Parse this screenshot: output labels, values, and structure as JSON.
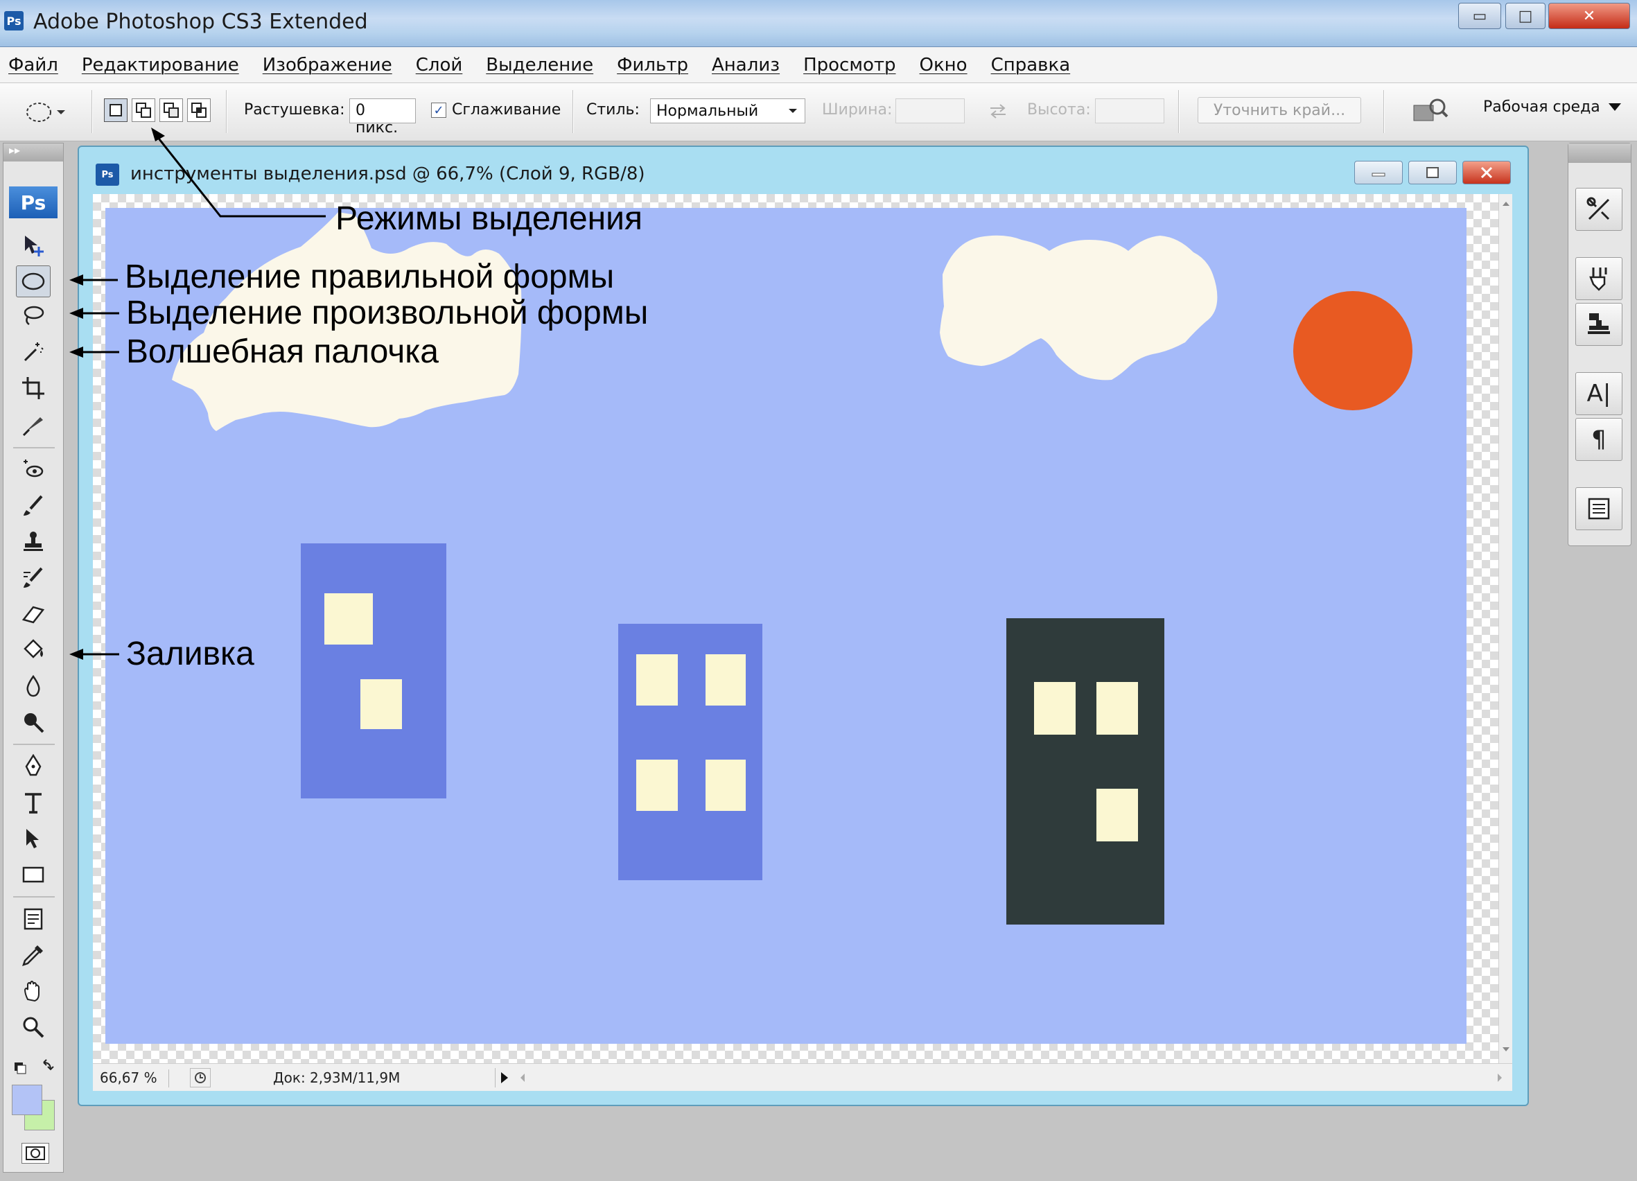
{
  "titlebar": {
    "app_badge": "Ps",
    "title": "Adobe Photoshop CS3 Extended",
    "minimize": "▭",
    "maximize": "□",
    "close": "✕"
  },
  "menu": {
    "items": [
      "Файл",
      "Редактирование",
      "Изображение",
      "Слой",
      "Выделение",
      "Фильтр",
      "Анализ",
      "Просмотр",
      "Окно",
      "Справка"
    ]
  },
  "options": {
    "feather_label": "Растушевка:",
    "feather_value": "0 пикс.",
    "antialias_label": "Сглаживание",
    "antialias_checked": "✓",
    "style_label": "Стиль:",
    "style_value": "Нормальный",
    "width_label": "Ширина:",
    "height_label": "Высота:",
    "refine_edge": "Уточнить край...",
    "workspace": "Рабочая среда"
  },
  "toolbox": {
    "header": "▸▸",
    "logo": "Ps",
    "tools": [
      "move-tool",
      "elliptical-marquee-tool",
      "lasso-tool",
      "magic-wand-tool",
      "crop-tool",
      "slice-tool",
      "spot-healing-tool",
      "brush-tool",
      "clone-stamp-tool",
      "history-brush-tool",
      "eraser-tool",
      "paint-bucket-tool",
      "blur-tool",
      "dodge-tool",
      "pen-tool",
      "type-tool",
      "path-selection-tool",
      "rectangle-tool",
      "notes-tool",
      "eyedropper-tool",
      "hand-tool",
      "zoom-tool"
    ],
    "foreground_color": "#b3c3f6",
    "background_color": "#c6f0a9"
  },
  "document": {
    "title": "инструменты выделения.psd @ 66,7% (Слой 9, RGB/8)",
    "icon": "Ps",
    "zoom": "66,67 %",
    "doc_info": "Док: 2,93M/11,9M"
  },
  "artwork": {
    "sky_color": "#a5baf9",
    "cloud_color": "#fbf7e9",
    "sun_color": "#e85a22",
    "house_color": "#6a80e2",
    "dark_house_color": "#2f3b3b",
    "window_color": "#fbf7d2"
  },
  "annotations": {
    "selection_modes": "Режимы выделения",
    "marquee": "Выделение правильной формы",
    "lasso": "Выделение произвольной формы",
    "magic_wand": "Волшебная палочка",
    "fill": "Заливка"
  },
  "right_panel": {
    "type_icon": "A|",
    "paragraph_icon": "¶"
  }
}
